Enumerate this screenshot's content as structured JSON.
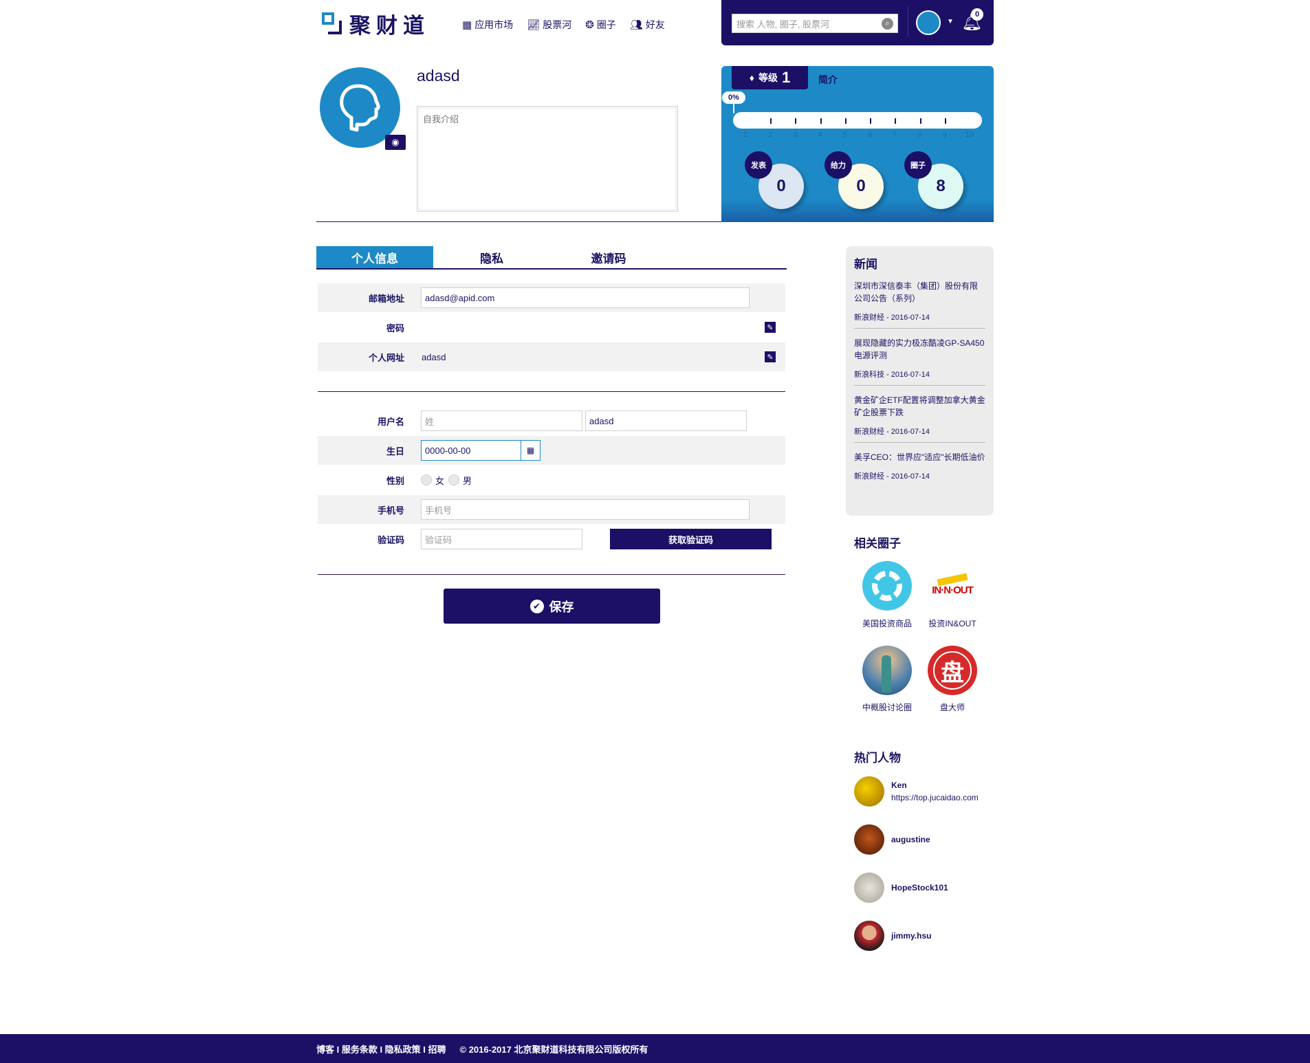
{
  "header": {
    "logo_text": "聚财道",
    "nav": [
      {
        "label": "应用市场",
        "icon": "grid-icon"
      },
      {
        "label": "股票河",
        "icon": "chart-icon"
      },
      {
        "label": "圈子",
        "icon": "circle-icon"
      },
      {
        "label": "好友",
        "icon": "friends-icon"
      }
    ],
    "search_placeholder": "搜索 人物, 圈子, 股票河",
    "notification_count": "0"
  },
  "profile": {
    "username": "adasd",
    "bio_placeholder": "自我介绍"
  },
  "level": {
    "label": "等级",
    "value": "1",
    "intro_tab": "简介",
    "progress_text": "0%",
    "progress": 0,
    "scale": [
      "1",
      "2",
      "3",
      "4",
      "5",
      "6",
      "7",
      "8",
      "9",
      "10"
    ],
    "stats": [
      {
        "label": "发表",
        "value": "0"
      },
      {
        "label": "给力",
        "value": "0"
      },
      {
        "label": "圈子",
        "value": "8"
      }
    ]
  },
  "tabs": [
    "个人信息",
    "隐私",
    "邀请码"
  ],
  "form": {
    "email_label": "邮箱地址",
    "email_value": "adasd@apid.com",
    "password_label": "密码",
    "url_label": "个人网址",
    "url_value": "adasd",
    "username_label": "用户名",
    "surname_placeholder": "姓",
    "given_name_value": "adasd",
    "birthday_label": "生日",
    "birthday_value": "0000-00-00",
    "gender_label": "性别",
    "gender_female": "女",
    "gender_male": "男",
    "phone_label": "手机号",
    "phone_placeholder": "手机号",
    "code_label": "验证码",
    "code_placeholder": "验证码",
    "get_code_button": "获取验证码",
    "save_button": "保存"
  },
  "sidebar": {
    "news_title": "新闻",
    "news": [
      {
        "title": "深圳市深信泰丰（集团）股份有限公司公告（系列）",
        "meta": "新浪财经 - 2016-07-14"
      },
      {
        "title": "展现隐藏的实力极冻酷凌GP-SA450电源评测",
        "meta": "新浪科技 - 2016-07-14"
      },
      {
        "title": "黄金矿企ETF配置将调整加拿大黄金矿企股票下跌",
        "meta": "新浪财经 - 2016-07-14"
      },
      {
        "title": "美孚CEO：世界应\"适应\"长期低油价",
        "meta": "新浪财经 - 2016-07-14"
      }
    ],
    "circles_title": "相关圈子",
    "circles": [
      {
        "name": "美国投资商品"
      },
      {
        "name": "投资IN&OUT",
        "logo_text": "IN·N·OUT"
      },
      {
        "name": "中概股讨论圈"
      },
      {
        "name": "盘大师",
        "logo_text": "盘"
      }
    ],
    "people_title": "热门人物",
    "people": [
      {
        "name": "Ken",
        "url": "https://top.jucaidao.com"
      },
      {
        "name": "augustine",
        "url": ""
      },
      {
        "name": "HopeStock101",
        "url": ""
      },
      {
        "name": "jimmy.hsu",
        "url": ""
      }
    ]
  },
  "footer": {
    "links": "博客 I 服务条款 I 隐私政策 I 招聘",
    "copyright": "© 2016-2017 北京聚财道科技有限公司版权所有"
  }
}
